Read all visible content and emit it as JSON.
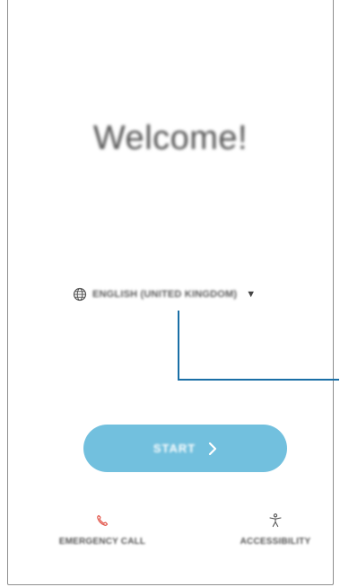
{
  "welcome": {
    "title": "Welcome!"
  },
  "language": {
    "icon": "globe-icon",
    "selected": "ENGLISH (UNITED KINGDOM)",
    "dropdown_icon": "caret-down-icon"
  },
  "start_button": {
    "label": "START",
    "icon": "chevron-right-icon",
    "color": "#72c0de"
  },
  "bottom_bar": {
    "emergency": {
      "label": "EMERGENCY CALL",
      "icon": "phone-icon",
      "icon_color": "#e2574c"
    },
    "accessibility": {
      "label": "ACCESSIBILITY",
      "icon": "accessibility-icon"
    }
  },
  "callout": {
    "color": "#1a6fa6"
  }
}
